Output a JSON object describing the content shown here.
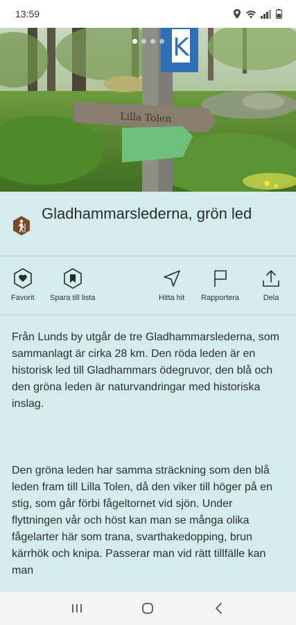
{
  "status_bar": {
    "time": "13:59",
    "icons": [
      "location-icon",
      "wifi-icon",
      "cellular-signal-icon",
      "battery-icon"
    ]
  },
  "hero": {
    "image_subject": "trail sign post in forest",
    "carousel_pages": 4,
    "carousel_active_index": 0
  },
  "trail": {
    "title": "Gladhammarslederna, grön led",
    "badge_icon": "hiker-icon",
    "badge_color": "#7a4a2a"
  },
  "actions": {
    "favorite": "Favorit",
    "save_to_list": "Spara till lista",
    "find_here": "Hitta hit",
    "report": "Rapportera",
    "share": "Dela"
  },
  "description": {
    "paragraph_1": " Från Lunds by utgår de tre Gladhammarslederna, som sammanlagt är cirka 28 km. Den röda leden är en historisk led till Gladhammars ödegruvor, den blå och den gröna leden är naturvandringar med historiska inslag.",
    "paragraph_2": "Den gröna leden har samma sträckning som den blå leden fram till Lilla Tolen, då den viker till höger på en stig, som går förbi fågeltornet vid sjön. Under flyttningen vår och höst kan man se många olika fågelarter här som trana, svarthakedopping, brun kärrhök och knipa. Passerar man vid rätt tillfälle kan man"
  },
  "colors": {
    "background": "#d5ecec",
    "accent_brown": "#7a4a2a",
    "divider": "#bcd6d6"
  }
}
